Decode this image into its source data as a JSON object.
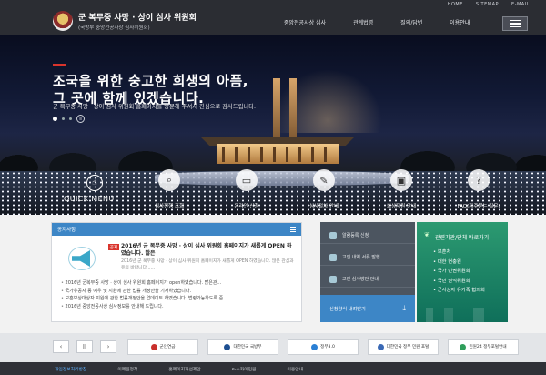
{
  "header": {
    "top_links": [
      "HOME",
      "SITEMAP",
      "E-MAIL"
    ],
    "site_title": "군 복무중 사망 · 상이 심사 위원회",
    "site_subtitle": "(국방부 중앙전공사상 심사위원회)",
    "nav": [
      "중앙전공사상 심사",
      "관계법령",
      "질의/답변",
      "이용안내"
    ]
  },
  "hero": {
    "headline_line1": "조국을 위한 숭고한 희생의 아픔,",
    "headline_line2": "그 곳에 함께 있겠습니다.",
    "subtext": "군 복무중 사망 · 상이 심사 위원회 홈페이지를 방문해 주셔서 진심으로 감사드립니다.",
    "pager_pause": "II"
  },
  "quick_menu": {
    "title": "QUICK MENU",
    "items": [
      "심사진행 조회",
      "온라인 신청",
      "심사절차 안내",
      "보상지원 안내",
      "FAQ(자주묻는 질문)"
    ]
  },
  "notice": {
    "title": "공지사항",
    "badge": "공지",
    "feature_title": "2016년 군 복무중 사망 · 상이 심사 위원회 홈페이지가 새롭게 OPEN 하였습니다. 많은",
    "feature_desc": "2016년 군 복무중 사망 · 상이 심사 위원회 홈페이지가 새롭게 OPEN 하였습니다. 많은 관심과 유의 바랍니다......",
    "items": [
      "2016년 군복무중 사망 · 상이 심사 위원회 홈페이지가 open하였습니다. 많은관...",
      "국가유공자 등 예우 및 지원에 관한 법률 개정안을 기재하였습니다.",
      "보훈보상대상자 지원에 관한 법률개정안을 업데이트 하였습니다. 법령가능하도록 준...",
      "2016년 중앙전공사상 심사정보를 안내해 드립니다."
    ]
  },
  "services": {
    "items": [
      "알람등록 신청",
      "고인 내역 서류 발행",
      "고인 심사방안 안내"
    ],
    "apply_label": "신청양식 내려받기"
  },
  "related": {
    "title": "관련기관/단체 바로가기",
    "items": [
      "보훈처",
      "대한 현충원",
      "국가 민권위원회",
      "국민 권익위원회",
      "군사상자 유가족 협의회"
    ]
  },
  "banners": {
    "prev": "‹",
    "pause": "II",
    "next": "›",
    "items": [
      "군인연금",
      "대한민국 국방부",
      "정부3.0",
      "대한민국 정부 민원 포털",
      "민원24 정부포털안내"
    ]
  },
  "footer": {
    "links": [
      "개인정보처리방침",
      "이메일정책",
      "홈페이지개선제안",
      "e-스카이민원",
      "이용안내"
    ]
  },
  "colors": {
    "header_bg": "#2b2d33",
    "notice_accent": "#3d86c6",
    "related_green": "#2c9a71",
    "badge_red": "#d9342c"
  }
}
